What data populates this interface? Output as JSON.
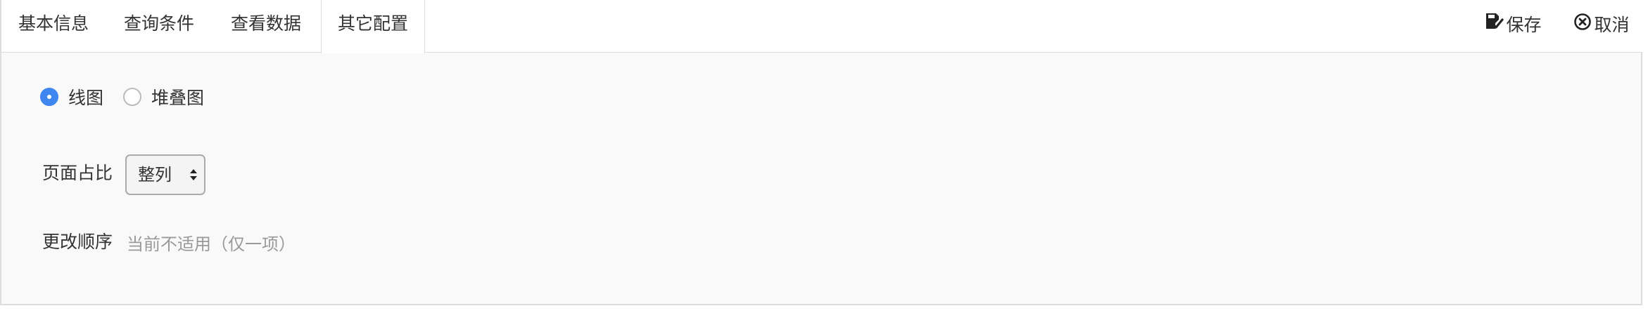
{
  "tabs": [
    {
      "label": "基本信息"
    },
    {
      "label": "查询条件"
    },
    {
      "label": "查看数据"
    },
    {
      "label": "其它配置"
    }
  ],
  "active_tab": "其它配置",
  "toolbar": {
    "save_label": "保存",
    "cancel_label": "取消"
  },
  "chart_type": {
    "options": [
      {
        "label": "线图",
        "checked": true
      },
      {
        "label": "堆叠图",
        "checked": false
      }
    ]
  },
  "page_ratio": {
    "label": "页面占比",
    "selected": "整列"
  },
  "order": {
    "label": "更改顺序",
    "hint": "当前不适用（仅一项）"
  },
  "colors": {
    "accent": "#3f86ef",
    "panel_bg": "#f9f9f9",
    "border": "#dddddd",
    "hint_text": "#999999"
  }
}
